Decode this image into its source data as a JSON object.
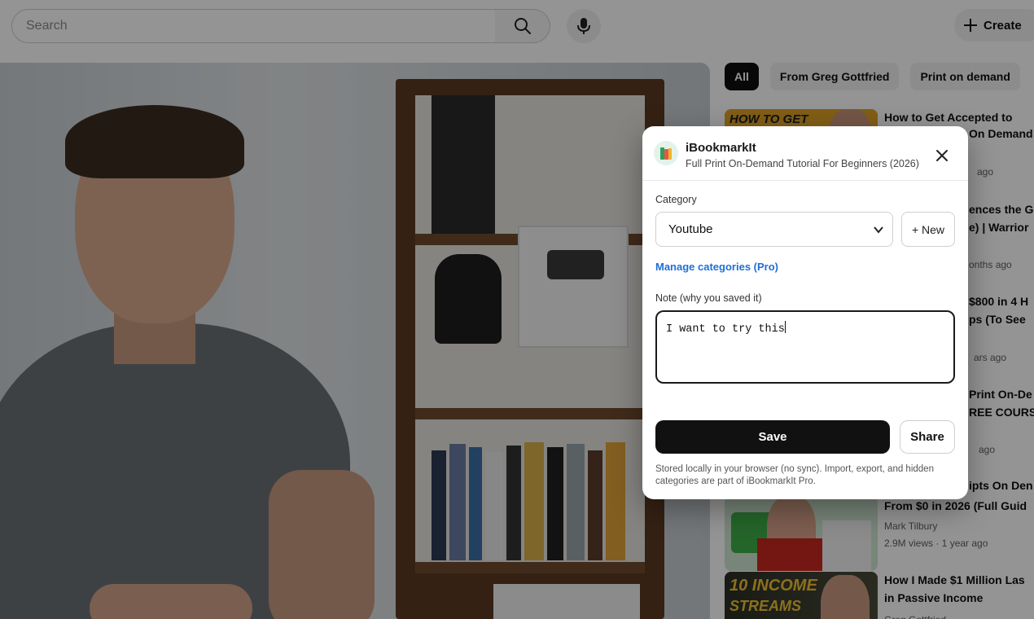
{
  "header": {
    "search_placeholder": "Search",
    "create_label": "Create"
  },
  "sidebar": {
    "chips": [
      {
        "label": "All"
      },
      {
        "label": "From Greg Gottfried"
      },
      {
        "label": "Print on demand"
      }
    ],
    "rec_fragments": {
      "r1_title": "How to Get Accepted to",
      "r1_title2": "On Demand",
      "r1_meta": "ago",
      "r2_title": "ences the Gr",
      "r2_title2": "e) | Warrior",
      "r2_meta": "onths ago",
      "r3_title": "$800 in 4 H",
      "r3_title2": "ps (To See",
      "r3_meta": "ars ago",
      "r4_title": "Print On-De",
      "r4_title2": "REE COURS",
      "r4_meta": "ago",
      "r5_title": "ipts On Den",
      "r5_title2": "From $0 in 2026 (Full Guid",
      "r5_channel": "Mark Tilbury",
      "r5_meta": "2.9M views · 1 year ago",
      "r6_title": "How I Made $1 Million Las",
      "r6_title2": "in Passive Income",
      "r6_channel": "Greg Gottfried"
    },
    "thumb_text": {
      "t1": "HOW TO GET",
      "t6a": "10 INCOME",
      "t6b": "STREAMS"
    }
  },
  "popup": {
    "app_name": "iBookmarkIt",
    "video_title": "Full Print On-Demand Tutorial For Beginners (2026)",
    "category_label": "Category",
    "category_selected": "Youtube",
    "new_button": "+ New",
    "manage_link": "Manage categories (Pro)",
    "note_label": "Note (why you saved it)",
    "note_value": "I want to try this",
    "save_button": "Save",
    "share_button": "Share",
    "footnote": "Stored locally in your browser (no sync). Import, export, and hidden categories are part of iBookmarkIt Pro."
  },
  "colors": {
    "accent_link": "#1f6fd6",
    "primary_button": "#111111",
    "overlay": "rgba(0,0,0,0.42)"
  }
}
